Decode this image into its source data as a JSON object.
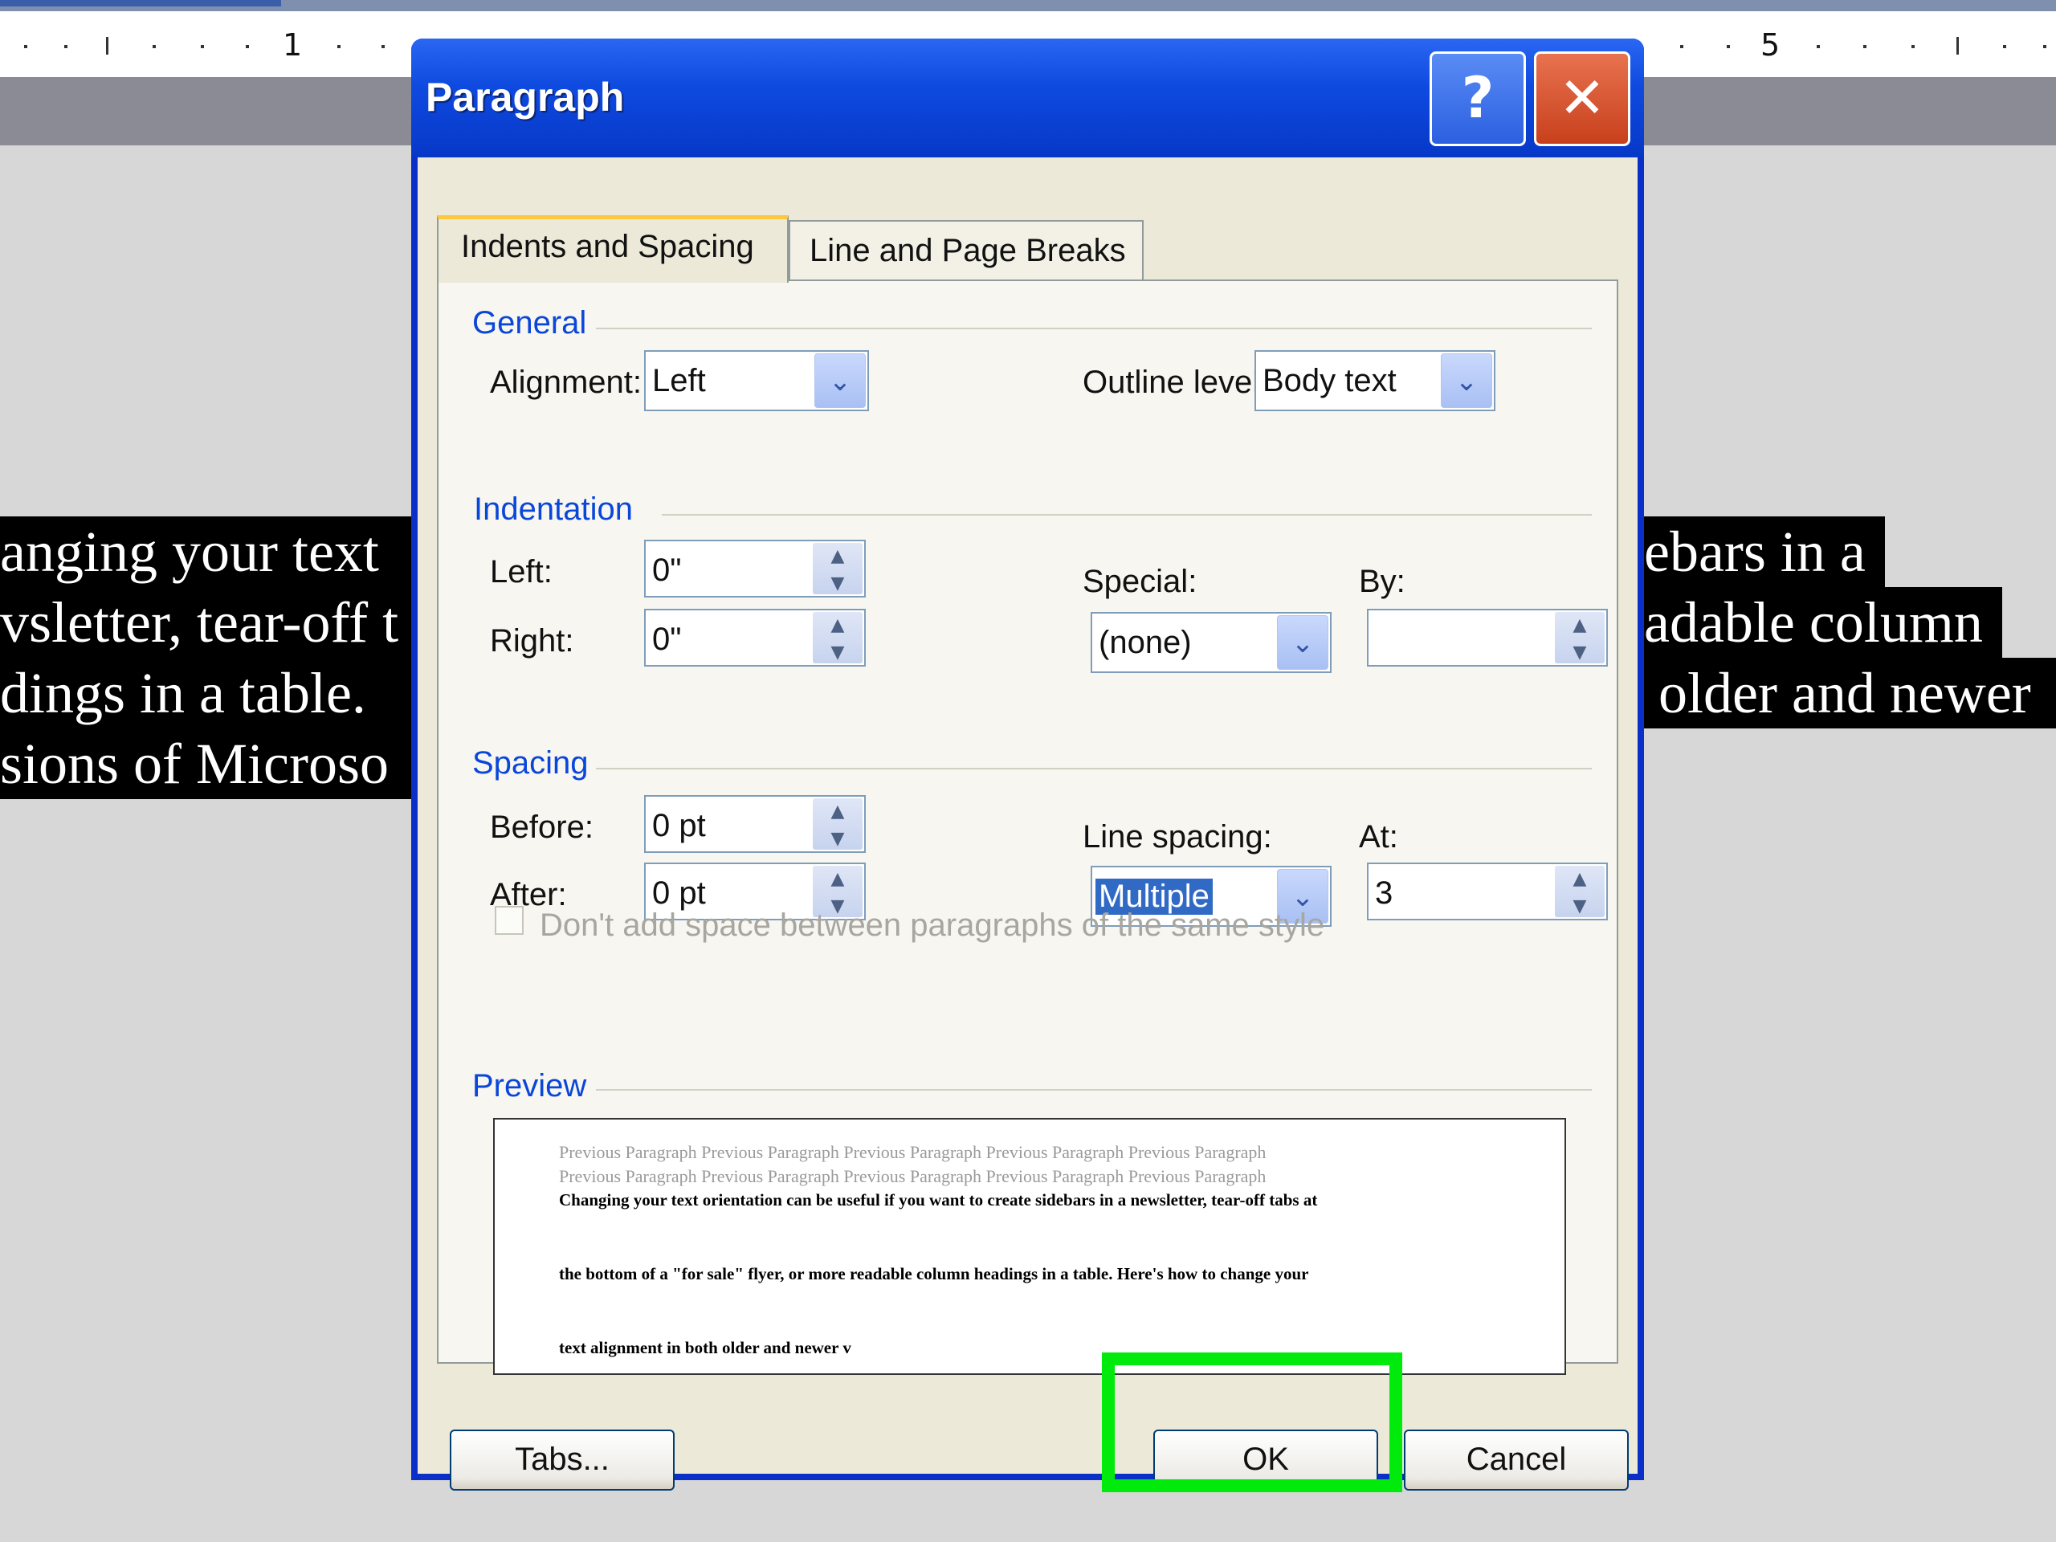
{
  "ruler": {
    "numbers": [
      "1",
      "5"
    ]
  },
  "document": {
    "left_lines": [
      "anging your text",
      "vsletter, tear-off t",
      "dings in a table.",
      "sions of Microso"
    ],
    "right_lines": [
      "ebars in a",
      "adable column",
      "older and newer"
    ]
  },
  "dialog": {
    "title": "Paragraph",
    "help_glyph": "?",
    "close_glyph": "✕",
    "tabs": [
      "Indents and Spacing",
      "Line and Page Breaks"
    ],
    "general": {
      "heading": "General",
      "alignment_label": "Alignment:",
      "alignment_value": "Left",
      "outline_label": "Outline level:",
      "outline_value": "Body text"
    },
    "indentation": {
      "heading": "Indentation",
      "left_label": "Left:",
      "left_value": "0\"",
      "right_label": "Right:",
      "right_value": "0\"",
      "special_label": "Special:",
      "special_value": "(none)",
      "by_label": "By:",
      "by_value": ""
    },
    "spacing": {
      "heading": "Spacing",
      "before_label": "Before:",
      "before_value": "0 pt",
      "after_label": "After:",
      "after_value": "0 pt",
      "line_spacing_label": "Line spacing:",
      "line_spacing_value": "Multiple",
      "at_label": "At:",
      "at_value": "3",
      "checkbox_label": "Don't add space between paragraphs of the same style"
    },
    "preview": {
      "heading": "Preview",
      "prev_line": "Previous Paragraph Previous Paragraph Previous Paragraph Previous Paragraph Previous Paragraph",
      "current_lines": [
        "Changing your text orientation can be useful if you want to create sidebars in a newsletter, tear-off tabs at",
        "the bottom of a \"for sale\" flyer, or more readable column headings in a table. Here's how to change your",
        "text alignment in both older and newer v"
      ]
    },
    "buttons": {
      "tabs": "Tabs...",
      "ok": "OK",
      "cancel": "Cancel"
    }
  },
  "colors": {
    "titlebar": "#0a4ae0",
    "close_button": "#d8542c",
    "group_heading": "#0a46d9",
    "highlight": "#00ea0c",
    "selection": "#316ac5"
  },
  "icons": [
    "help-icon",
    "close-icon",
    "chevron-down-icon",
    "spin-up-icon",
    "spin-down-icon"
  ]
}
